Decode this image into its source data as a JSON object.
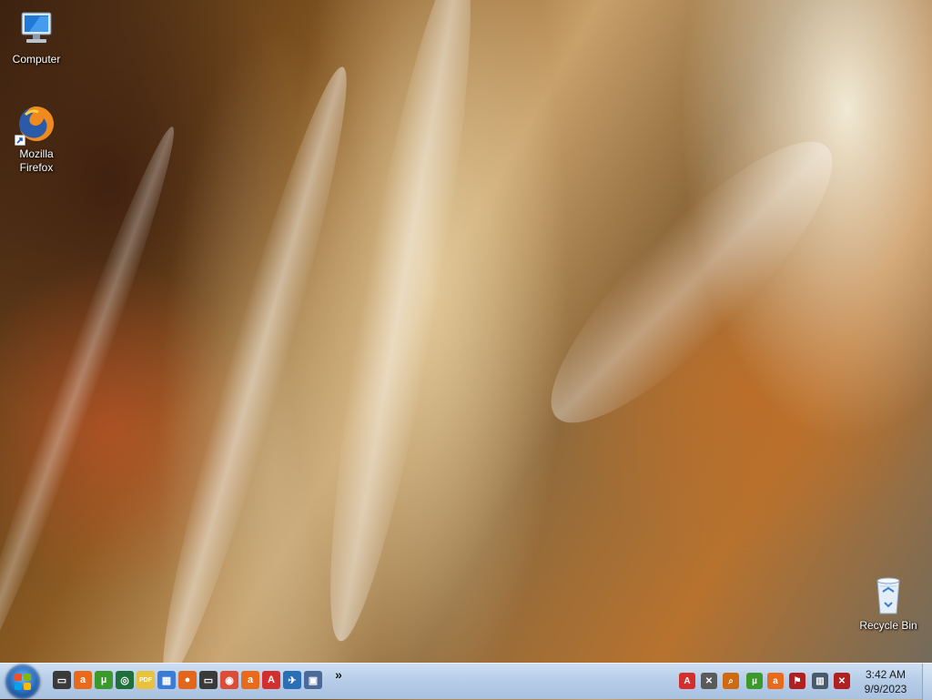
{
  "desktop": {
    "icons": [
      {
        "label": "Computer",
        "icon": "computer-icon"
      },
      {
        "label": "Mozilla\nFirefox",
        "icon": "firefox-icon"
      },
      {
        "label": "Recycle Bin",
        "icon": "recycle-bin-icon"
      }
    ]
  },
  "taskbar": {
    "pinned": [
      {
        "icon": "window-app-icon",
        "glyph": "▭",
        "color": "#3a3a3a"
      },
      {
        "icon": "avast-icon",
        "glyph": "a",
        "color": "#e86a1a"
      },
      {
        "icon": "utorrent-icon",
        "glyph": "µ",
        "color": "#3c9a2d"
      },
      {
        "icon": "media-player-icon",
        "glyph": "◎",
        "color": "#1f6f3a"
      },
      {
        "icon": "pdf-icon",
        "glyph": "PDF",
        "color": "#e8c23a"
      },
      {
        "icon": "tiles-app-icon",
        "glyph": "▦",
        "color": "#3a7bd5"
      },
      {
        "icon": "firefox-icon",
        "glyph": "●",
        "color": "#e4661b"
      },
      {
        "icon": "window-app-icon-2",
        "glyph": "▭",
        "color": "#3a3a3a"
      },
      {
        "icon": "chrome-icon",
        "glyph": "◉",
        "color": "#dd4b39"
      },
      {
        "icon": "avast-icon-2",
        "glyph": "a",
        "color": "#e86a1a"
      },
      {
        "icon": "acrobat-icon",
        "glyph": "A",
        "color": "#d32f2f"
      },
      {
        "icon": "plane-app-icon",
        "glyph": "✈",
        "color": "#2a6fb6"
      },
      {
        "icon": "network-app-icon",
        "glyph": "▣",
        "color": "#4a6a9a"
      }
    ],
    "overflow_glyph": "»",
    "tray": [
      {
        "icon": "acrobat-tray-icon",
        "glyph": "A",
        "color": "#d32f2f"
      },
      {
        "icon": "tools-tray-icon",
        "glyph": "✕",
        "color": "#5a5a5a"
      },
      {
        "icon": "search-tray-icon",
        "glyph": "⌕",
        "color": "#d06a10"
      },
      {
        "icon": "utorrent-tray-icon",
        "glyph": "µ",
        "color": "#3c9a2d"
      },
      {
        "icon": "avast-tray-icon",
        "glyph": "a",
        "color": "#e86a1a"
      },
      {
        "icon": "flag-tray-icon",
        "glyph": "⚑",
        "color": "#b02020"
      },
      {
        "icon": "network-tray-icon",
        "glyph": "▥",
        "color": "#4a5a6a"
      },
      {
        "icon": "volume-muted-icon",
        "glyph": "✕",
        "color": "#b02020"
      }
    ],
    "clock": {
      "time": "3:42 AM",
      "date": "9/9/2023"
    }
  }
}
